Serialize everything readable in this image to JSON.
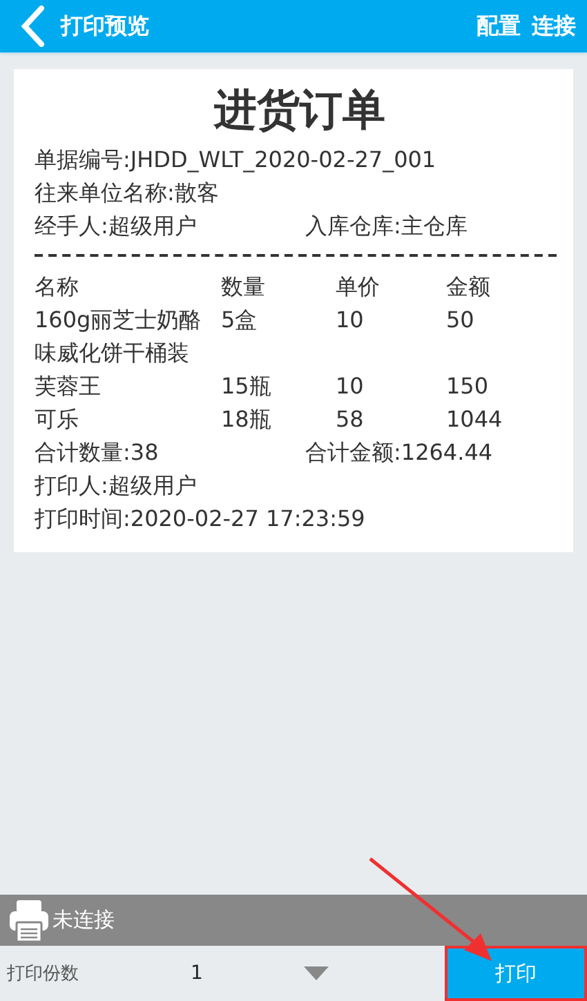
{
  "header": {
    "title": "打印预览",
    "actions": [
      "配置",
      "连接"
    ]
  },
  "document": {
    "title": "进货订单",
    "lines": [
      "单据编号:JHDD_WLT_2020-02-27_001",
      "往来单位名称:散客"
    ],
    "pair": [
      "经手人:超级用户",
      "入库仓库:主仓库"
    ],
    "columns": [
      "名称",
      "数量",
      "单价",
      "金额"
    ],
    "rows": [
      [
        "160g丽芝士奶酪味威化饼干桶装",
        "5盒",
        "10",
        "50"
      ],
      [
        "芙蓉王",
        "15瓶",
        "10",
        "150"
      ],
      [
        "可乐",
        "18瓶",
        "58",
        "1044"
      ]
    ],
    "totals": [
      "合计数量:38",
      "合计金额:1264.44"
    ],
    "footer": [
      "打印人:超级用户",
      "打印时间:2020-02-27 17:23:59"
    ]
  },
  "printer_status": "未连接",
  "copies": {
    "label": "打印份数",
    "value": "1"
  },
  "print_button": "打印"
}
